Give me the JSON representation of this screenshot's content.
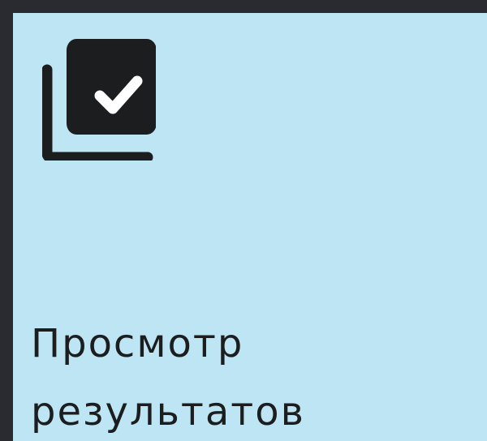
{
  "tile": {
    "icon": "checked-stack-icon",
    "label_line1": "Просмотр",
    "label_line2": "результатов"
  },
  "colors": {
    "background": "#2a2b30",
    "tile": "#bde5f3",
    "icon": "#1b1d1f",
    "text": "#1b1d1f"
  }
}
